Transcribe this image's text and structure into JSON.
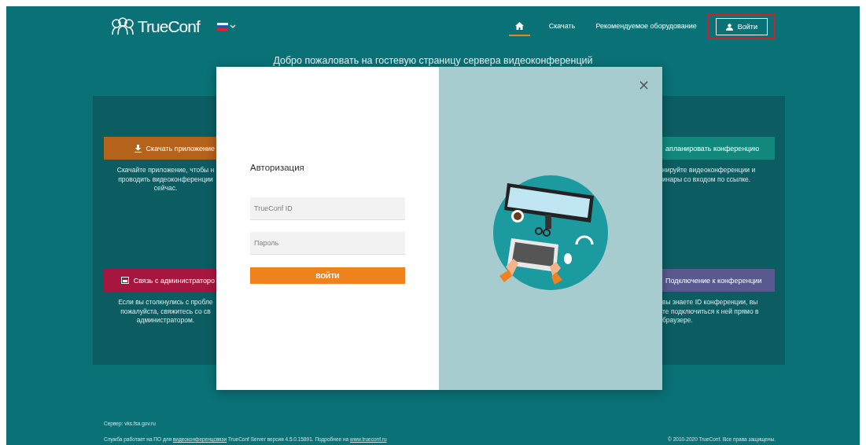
{
  "header": {
    "logo": "TrueConf",
    "nav": [
      {
        "kind": "home",
        "selected": true
      },
      {
        "kind": "text",
        "label": "Скачать",
        "selected": false
      },
      {
        "kind": "text",
        "label": "Рекомендуемое оборудование",
        "selected": false
      }
    ],
    "login_button": {
      "label": "Войти",
      "highlighted": true
    }
  },
  "welcome_title": "Добро пожаловать на гостевую страницу сервера видеоконференций",
  "left_cards": [
    {
      "kind": "download",
      "button": "Скачать приложение",
      "color": "#b5621a",
      "lines": [
        "Скачайте приложение, чтобы н",
        "проводить видеоконференции",
        "сейчас."
      ]
    },
    {
      "kind": "contact",
      "button": "Связь с администраторо",
      "color": "#a5173f",
      "lines": [
        "Если вы столкнулись с пробле",
        "пожалуйста, свяжитесь со св",
        "администратором."
      ]
    }
  ],
  "right_cards": [
    {
      "button": "апланировать конференцию",
      "color": "#12877c",
      "lines": [
        "нируйте видеоконференции и",
        "инары со входом по ссылке."
      ]
    },
    {
      "button": "Подключение к конференции",
      "color": "#58598f",
      "lines": [
        "вы знаете ID конференции, вы",
        "те подключиться к ней прямо в",
        "браузере."
      ]
    }
  ],
  "modal": {
    "title": "Авторизация",
    "fields": [
      {
        "placeholder": "TrueConf ID"
      },
      {
        "placeholder": "Пароль"
      }
    ],
    "submit": "ВОЙТИ",
    "close": "×"
  },
  "footer": {
    "server": "Сервер: vks.fsa.gov.ru",
    "service": [
      {
        "kind": "text",
        "text": "Служба работает на ПО для "
      },
      {
        "kind": "link",
        "text": "видеоконференцсвязи"
      },
      {
        "kind": "text",
        "text": " TrueConf Server версия 4.5.0.15891. Подробнее на "
      },
      {
        "kind": "link",
        "text": "www.trueconf.ru"
      }
    ],
    "copyright": "© 2010-2020 TrueConf. Все права защищены."
  }
}
